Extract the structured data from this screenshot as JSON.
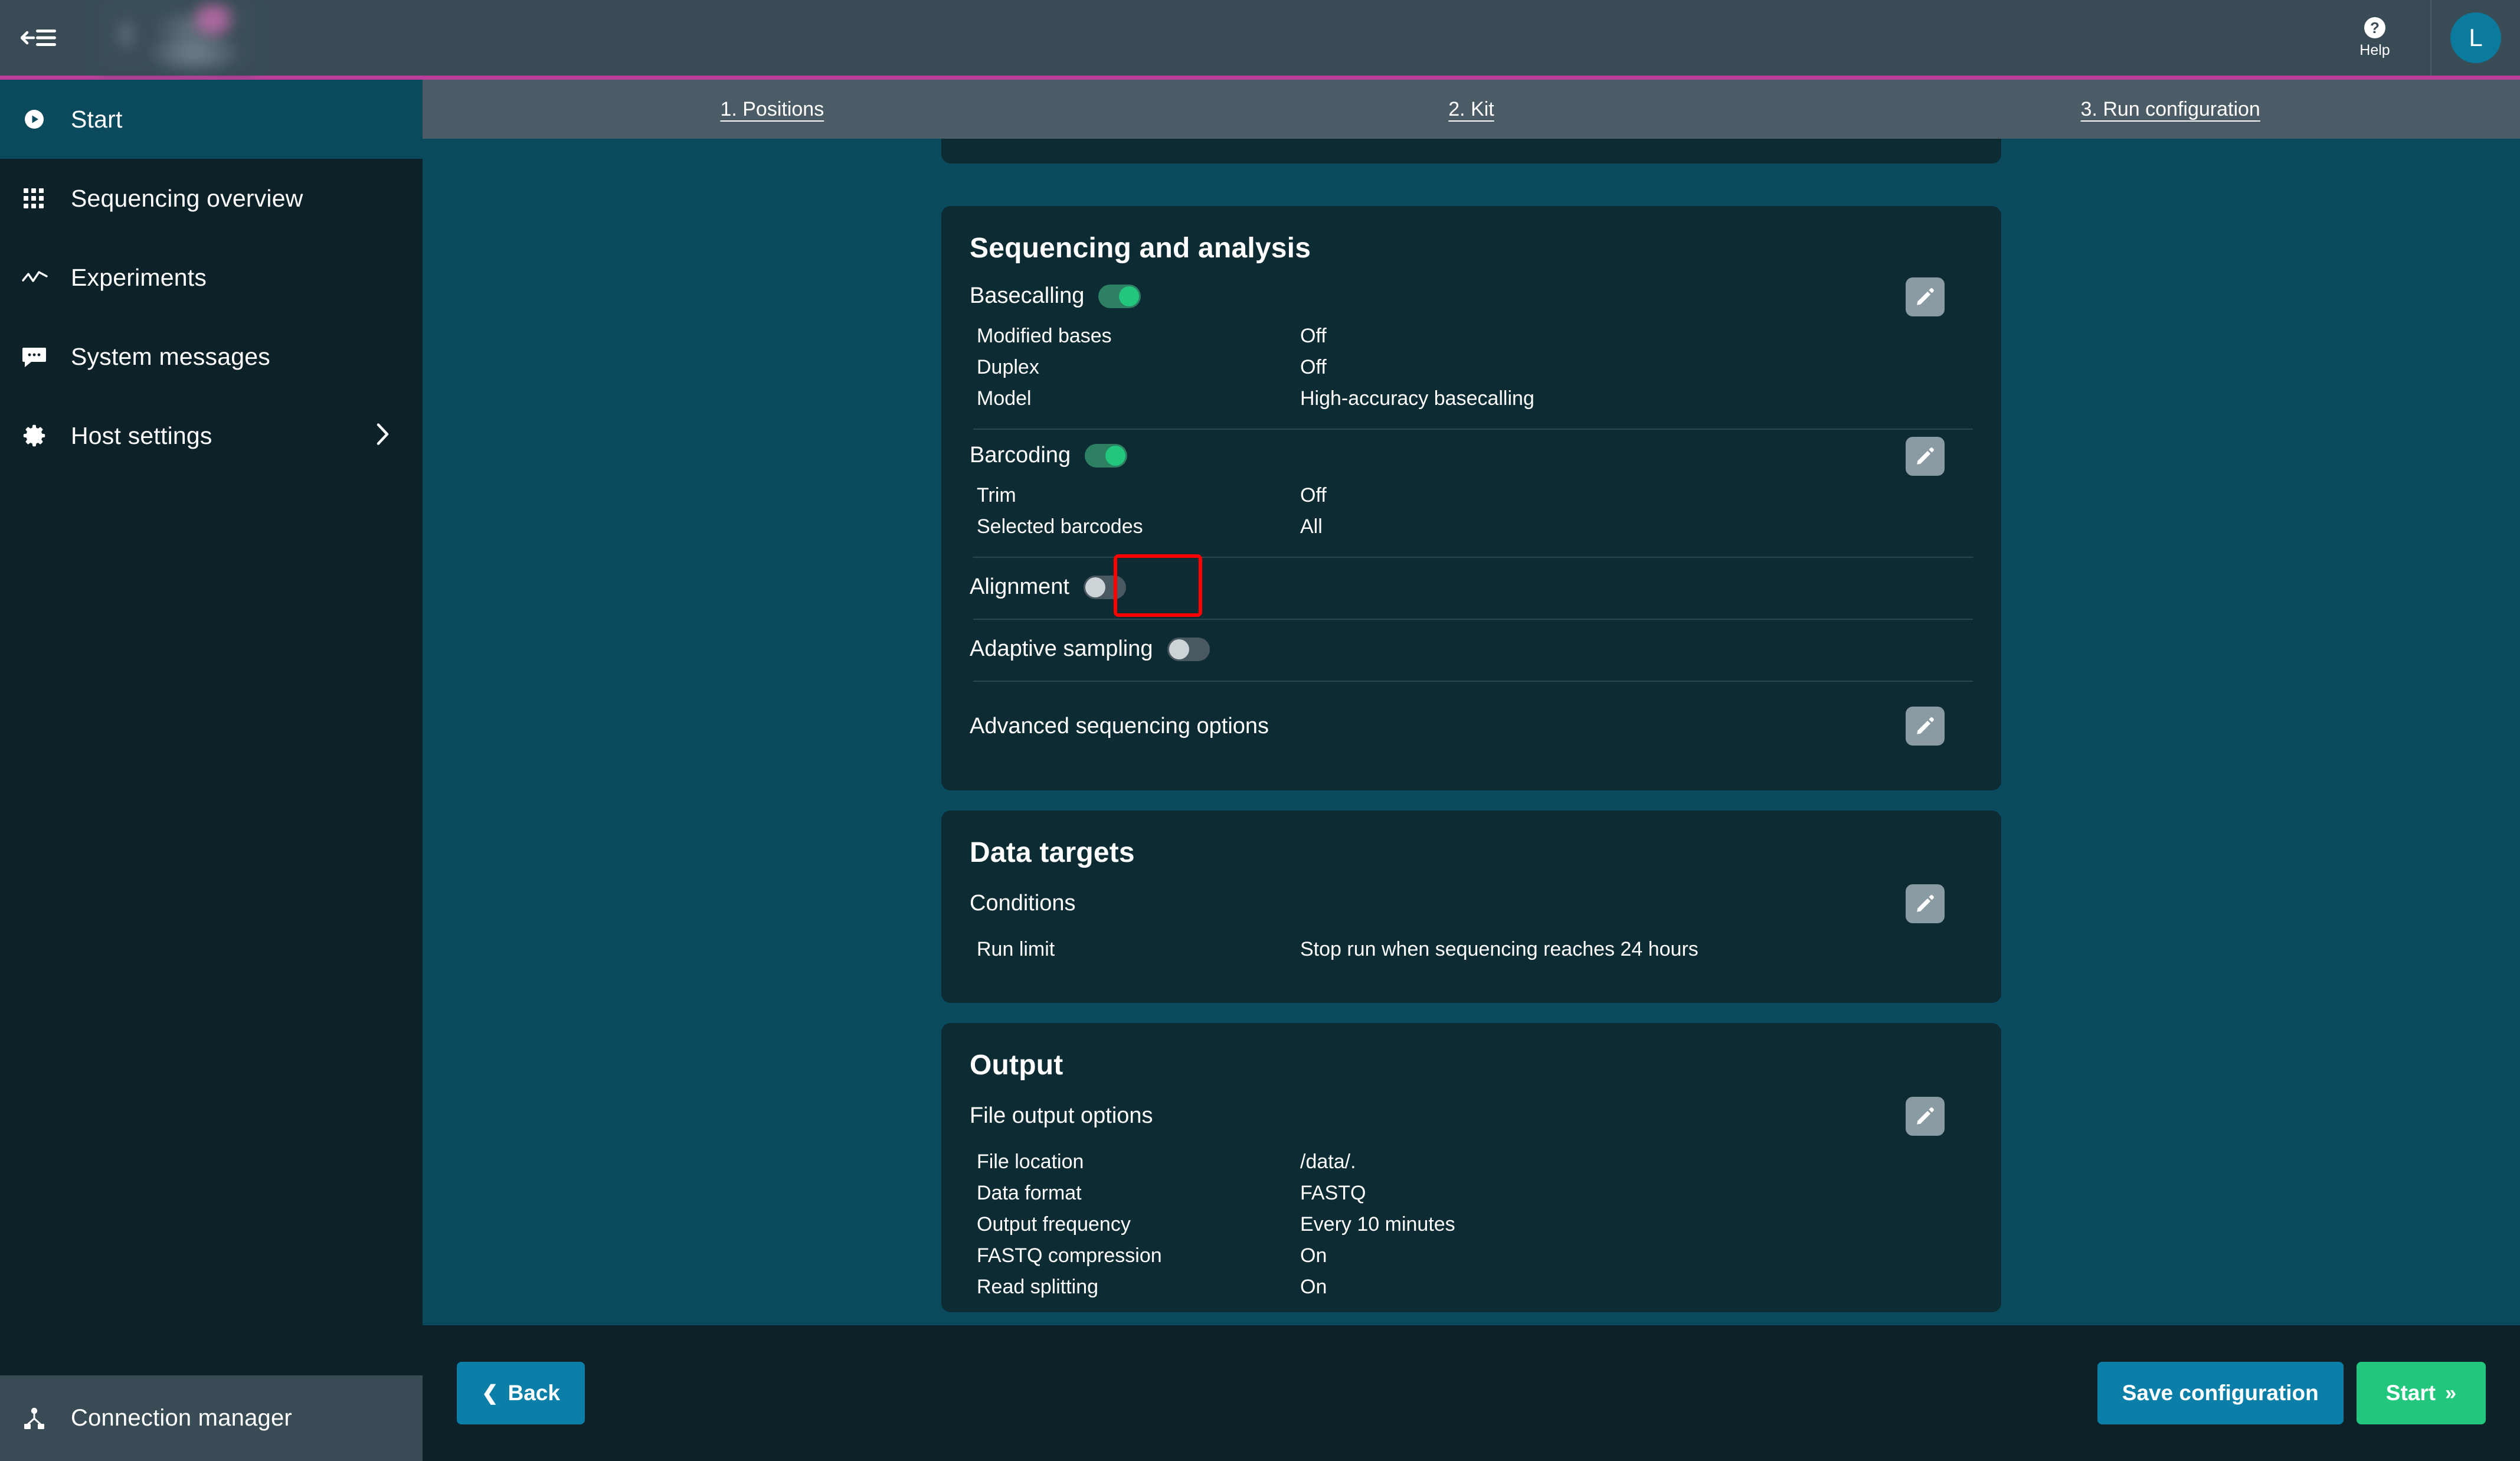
{
  "colors": {
    "accent_magenta": "#bb3f9a",
    "page_bg": "#0a4a5c",
    "card_bg": "#0d2b33",
    "sidebar_bg": "#0d2228",
    "topbar_bg": "#394c56",
    "tabbar_bg": "#4c5c66",
    "toggle_on": "#22c67d",
    "toggle_off": "#4a5860",
    "primary_button": "#0b7fa8",
    "start_button": "#22c67d",
    "highlight": "#ff0000"
  },
  "sidebar": {
    "collapse_icon": "collapse-arrow-menu-icon",
    "brand_logo": "",
    "items": [
      {
        "label": "Start",
        "icon": "play-circle-icon",
        "active": true,
        "has_chevron": false
      },
      {
        "label": "Sequencing overview",
        "icon": "grid-dots-icon",
        "active": false,
        "has_chevron": false
      },
      {
        "label": "Experiments",
        "icon": "line-chart-icon",
        "active": false,
        "has_chevron": false
      },
      {
        "label": "System messages",
        "icon": "speech-bubble-icon",
        "active": false,
        "has_chevron": false
      },
      {
        "label": "Host settings",
        "icon": "gear-icon",
        "active": false,
        "has_chevron": true
      }
    ],
    "footer": {
      "label": "Connection manager",
      "icon": "network-node-icon"
    }
  },
  "topbar": {
    "help_label": "Help",
    "help_icon": "question-mark-circle-icon",
    "avatar_initial": "L"
  },
  "tabs": [
    {
      "label": "1. Positions"
    },
    {
      "label": "2. Kit"
    },
    {
      "label": "3. Run configuration"
    }
  ],
  "cards": {
    "sequencing": {
      "title": "Sequencing and analysis",
      "basecalling": {
        "label": "Basecalling",
        "toggle_state": "on",
        "rows": [
          {
            "key": "Modified bases",
            "value": "Off"
          },
          {
            "key": "Duplex",
            "value": "Off"
          },
          {
            "key": "Model",
            "value": "High-accuracy basecalling"
          }
        ]
      },
      "barcoding": {
        "label": "Barcoding",
        "toggle_state": "on",
        "rows": [
          {
            "key": "Trim",
            "value": "Off"
          },
          {
            "key": "Selected barcodes",
            "value": "All"
          }
        ]
      },
      "alignment": {
        "label": "Alignment",
        "toggle_state": "off",
        "highlighted": true
      },
      "adaptive_sampling": {
        "label": "Adaptive sampling",
        "toggle_state": "off"
      },
      "advanced": {
        "label": "Advanced sequencing options"
      }
    },
    "data_targets": {
      "title": "Data targets",
      "conditions_label": "Conditions",
      "rows": [
        {
          "key": "Run limit",
          "value": "Stop run when sequencing reaches 24 hours"
        }
      ]
    },
    "output": {
      "title": "Output",
      "file_output_label": "File output options",
      "rows": [
        {
          "key": "File location",
          "value": "/data/."
        },
        {
          "key": "Data format",
          "value": "FASTQ"
        },
        {
          "key": "Output frequency",
          "value": "Every 10 minutes"
        },
        {
          "key": "FASTQ compression",
          "value": "On"
        },
        {
          "key": "Read splitting",
          "value": "On"
        }
      ]
    }
  },
  "actionbar": {
    "back_label": "Back",
    "back_icon": "chevron-left-icon",
    "save_label": "Save configuration",
    "start_label": "Start",
    "start_icon": "double-chevron-right-icon"
  }
}
